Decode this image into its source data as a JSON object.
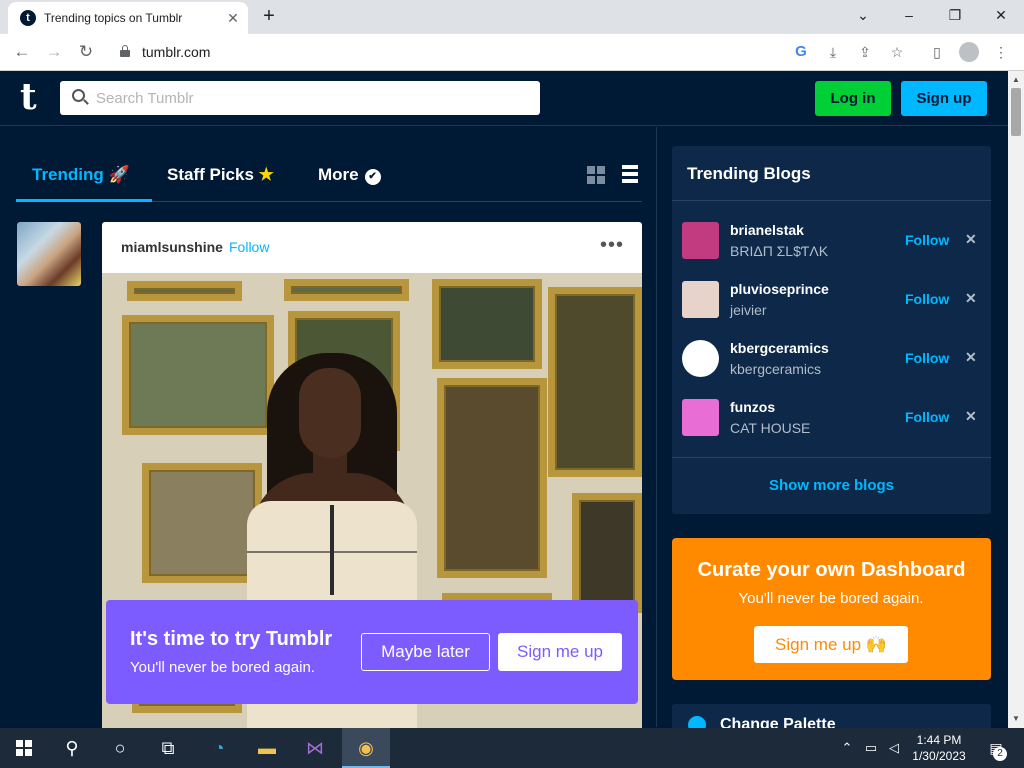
{
  "browser": {
    "tab_title": "Trending topics on Tumblr",
    "favicon_letter": "t",
    "url": "tumblr.com"
  },
  "header": {
    "logo": "t",
    "search_placeholder": "Search Tumblr",
    "login_label": "Log in",
    "signup_label": "Sign up"
  },
  "feed_tabs": [
    {
      "label": "Trending",
      "emoji": "🚀",
      "active": true
    },
    {
      "label": "Staff Picks",
      "emoji": "★",
      "active": false
    },
    {
      "label": "More",
      "active": false
    }
  ],
  "post": {
    "username": "miamlsunshine",
    "follow_label": "Follow",
    "more_label": "•••"
  },
  "promo": {
    "title": "It's time to try Tumblr",
    "subtitle": "You'll never be bored again.",
    "maybe_later": "Maybe later",
    "sign_me_up": "Sign me up"
  },
  "sidebar": {
    "trending_title": "Trending Blogs",
    "blogs": [
      {
        "name": "brianelstak",
        "title": "BRIΔП ΣL$ƬΛK",
        "follow": "Follow",
        "dismiss": "✕",
        "avatar_color": "#c23b80"
      },
      {
        "name": "pluvioseprince",
        "title": "jeivier",
        "follow": "Follow",
        "dismiss": "✕",
        "avatar_color": "#e7d3c9"
      },
      {
        "name": "kbergceramics",
        "title": "kbergceramics",
        "follow": "Follow",
        "dismiss": "✕",
        "avatar_color": "#ffffff"
      },
      {
        "name": "funzos",
        "title": "CAT HOUSE",
        "follow": "Follow",
        "dismiss": "✕",
        "avatar_color": "#e86ed6"
      }
    ],
    "show_more": "Show more blogs",
    "curate_title": "Curate your own Dashboard",
    "curate_subtitle": "You'll never be bored again.",
    "curate_button": "Sign me up 🙌",
    "palette_label": "Change Palette"
  },
  "taskbar": {
    "time": "1:44 PM",
    "date": "1/30/2023",
    "notification_count": "2"
  },
  "colors": {
    "tumblr_navy": "#001935",
    "accent_blue": "#00b8ff",
    "login_green": "#00cf35",
    "promo_purple": "#7c5cff",
    "curate_orange": "#ff8a00"
  }
}
